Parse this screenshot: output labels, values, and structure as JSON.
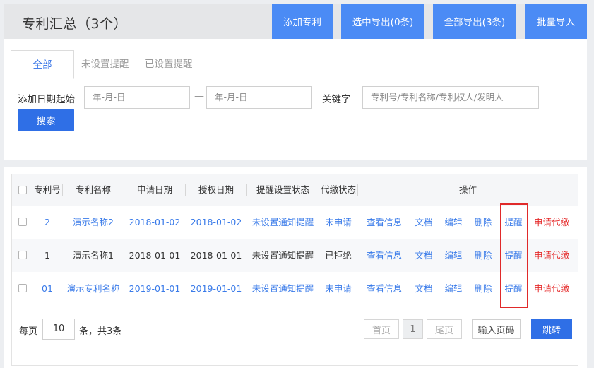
{
  "header": {
    "title": "专利汇总（3个）",
    "buttons": [
      "添加专利",
      "选中导出(0条)",
      "全部导出(3条)",
      "批量导入"
    ]
  },
  "tabs": [
    "全部",
    "未设置提醒",
    "已设置提醒"
  ],
  "filters": {
    "date_label": "添加日期起始",
    "date_from_placeholder": "年-月-日",
    "date_separator": "—",
    "date_to_placeholder": "年-月-日",
    "keyword_label": "关键字",
    "keyword_placeholder": "专利号/专利名称/专利权人/发明人",
    "search_label": "搜索"
  },
  "table": {
    "columns": [
      "专利号",
      "专利名称",
      "申请日期",
      "授权日期",
      "提醒设置状态",
      "代缴状态",
      "操作"
    ],
    "actions": [
      "查看信息",
      "文档",
      "编辑",
      "删除",
      "提醒",
      "申请代缴"
    ],
    "rows": [
      {
        "id": "2",
        "name": "演示名称2",
        "apply_date": "2018-01-02",
        "grant_date": "2018-01-02",
        "reminder_status": "未设置通知提醒",
        "payment_status": "未申请"
      },
      {
        "id": "1",
        "name": "演示名称1",
        "apply_date": "2018-01-01",
        "grant_date": "2018-01-01",
        "reminder_status": "未设置通知提醒",
        "payment_status": "已拒绝"
      },
      {
        "id": "01",
        "name": "演示专利名称",
        "apply_date": "2019-01-01",
        "grant_date": "2019-01-01",
        "reminder_status": "未设置通知提醒",
        "payment_status": "未申请"
      }
    ]
  },
  "pagination": {
    "per_page_prefix": "每页",
    "per_page_value": "10",
    "per_page_suffix": "条，共3条",
    "first": "首页",
    "current": "1",
    "last": "尾页",
    "goto_placeholder": "输入页码",
    "jump": "跳转"
  },
  "colors": {
    "primary": "#2f6fe6",
    "header_button": "#4b8bf5",
    "link": "#3a7be9",
    "danger": "#e52b2b",
    "highlight_border": "#e02a2a"
  }
}
